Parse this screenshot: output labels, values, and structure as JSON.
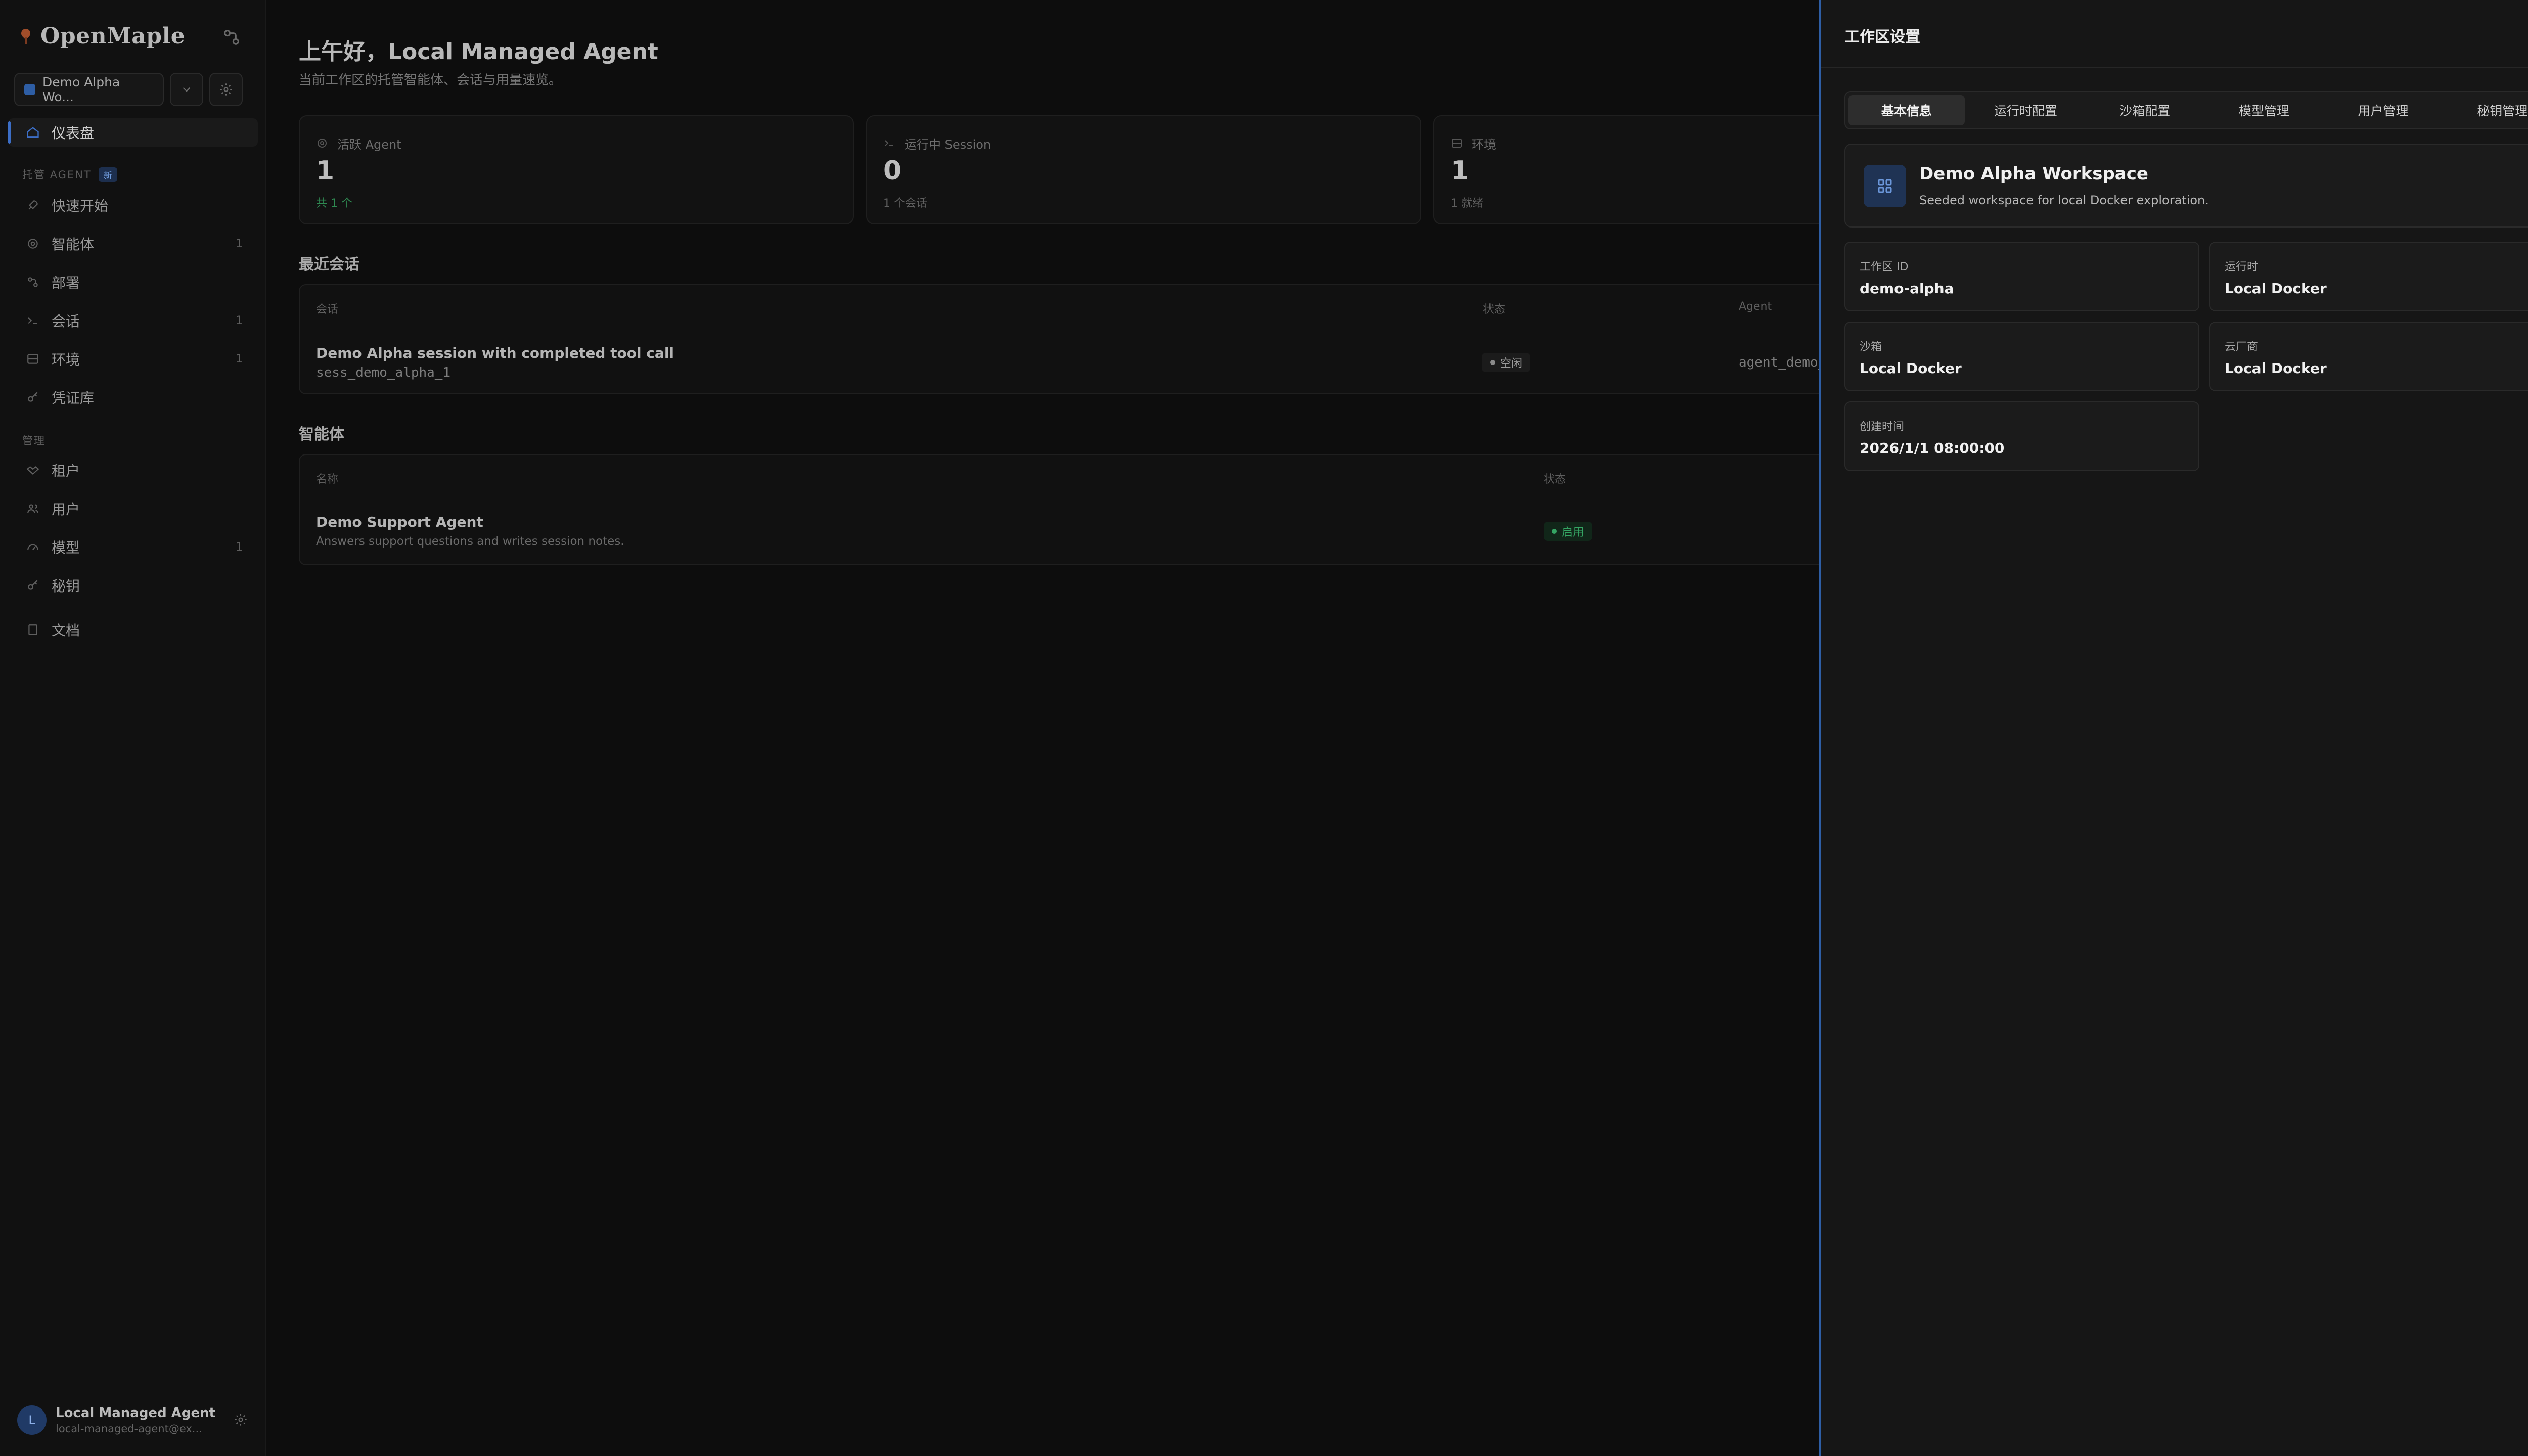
{
  "app": {
    "brand": "OpenMaple"
  },
  "workspace_selector": {
    "selected": "Demo Alpha Wo..."
  },
  "sidebar": {
    "active": {
      "label": "仪表盘",
      "icon": "home-icon"
    },
    "sections": [
      {
        "label": "托管 AGENT",
        "badge": "新"
      },
      {
        "label": "管理"
      }
    ],
    "agent_items": [
      {
        "label": "快速开始",
        "icon": "rocket-icon",
        "count": ""
      },
      {
        "label": "智能体",
        "icon": "bot-icon",
        "count": "1"
      },
      {
        "label": "部署",
        "icon": "deploy-icon",
        "count": ""
      },
      {
        "label": "会话",
        "icon": "terminal-icon",
        "count": "1"
      },
      {
        "label": "环境",
        "icon": "server-icon",
        "count": "1"
      },
      {
        "label": "凭证库",
        "icon": "key-icon",
        "count": ""
      }
    ],
    "admin_items": [
      {
        "label": "租户",
        "icon": "handshake-icon",
        "count": ""
      },
      {
        "label": "用户",
        "icon": "users-icon",
        "count": ""
      },
      {
        "label": "模型",
        "icon": "gauge-icon",
        "count": "1"
      },
      {
        "label": "秘钥",
        "icon": "key-icon",
        "count": ""
      }
    ],
    "docs": {
      "label": "文档",
      "icon": "book-icon"
    },
    "user": {
      "initial": "L",
      "name": "Local Managed Agent",
      "email": "local-managed-agent@ex..."
    }
  },
  "main": {
    "greeting": "上午好，Local Managed Agent",
    "subtitle": "当前工作区的托管智能体、会话与用量速览。",
    "stats": [
      {
        "label": "活跃 Agent",
        "icon": "bot-icon",
        "value": "1",
        "foot": "共 1 个"
      },
      {
        "label": "运行中 Session",
        "icon": "terminal-icon",
        "value": "0",
        "foot": "1 个会话"
      },
      {
        "label": "环境",
        "icon": "server-icon",
        "value": "1",
        "foot": "1 就绪"
      }
    ],
    "recent_sessions": {
      "title": "最近会话",
      "columns": [
        "会话",
        "状态",
        "Agent"
      ],
      "rows": [
        {
          "title": "Demo Alpha session with completed tool call",
          "id": "sess_demo_alpha_1",
          "status": "空闲",
          "agent": "agent_demo_supp"
        }
      ]
    },
    "agents": {
      "title": "智能体",
      "columns": [
        "名称",
        "状态"
      ],
      "rows": [
        {
          "name": "Demo Support Agent",
          "desc": "Answers support questions and writes session notes.",
          "status": "启用"
        }
      ]
    }
  },
  "settings_panel": {
    "title": "工作区设置",
    "tabs": [
      "基本信息",
      "运行时配置",
      "沙箱配置",
      "模型管理",
      "用户管理",
      "秘钥管理"
    ],
    "active_tab": "基本信息",
    "workspace": {
      "name": "Demo Alpha Workspace",
      "description": "Seeded workspace for local Docker exploration."
    },
    "fields": [
      {
        "label": "工作区 ID",
        "value": "demo-alpha"
      },
      {
        "label": "运行时",
        "value": "Local Docker"
      },
      {
        "label": "沙箱",
        "value": "Local Docker"
      },
      {
        "label": "云厂商",
        "value": "Local Docker"
      },
      {
        "label": "创建时间",
        "value": "2026/1/1 08:00:00"
      }
    ]
  }
}
